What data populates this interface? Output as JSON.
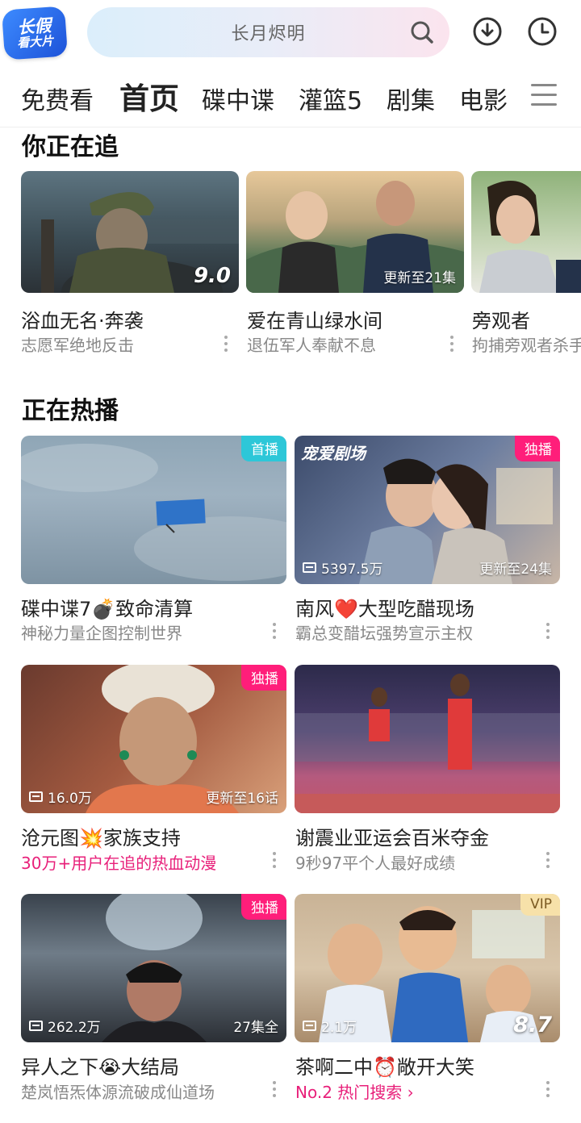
{
  "logo": {
    "line1": "长假",
    "line2": "看大片"
  },
  "search": {
    "placeholder": "长月烬明"
  },
  "icons": {
    "search": "search-icon",
    "download": "download-icon",
    "history": "history-icon",
    "menu": "menu-icon"
  },
  "tabs": [
    {
      "label": "免费看",
      "active": false
    },
    {
      "label": "首页",
      "active": true
    },
    {
      "label": "碟中谍",
      "active": false
    },
    {
      "label": "灌篮5",
      "active": false
    },
    {
      "label": "剧集",
      "active": false
    },
    {
      "label": "电影",
      "active": false
    }
  ],
  "following": {
    "title": "你正在追",
    "items": [
      {
        "title": "浴血无名·奔袭",
        "subtitle": "志愿军绝地反击",
        "overlay": "9.0"
      },
      {
        "title": "爱在青山绿水间",
        "subtitle": "退伍军人奉献不息",
        "overlay": "更新至21集"
      },
      {
        "title": "旁观者",
        "subtitle": "拘捕旁观者杀手",
        "overlay": ""
      }
    ]
  },
  "hot": {
    "title": "正在热播",
    "items": [
      {
        "title": "碟中谍7💣致命清算",
        "subtitle": "神秘力量企图控制世界",
        "badge": "首播",
        "views": "",
        "episodes": "",
        "score": ""
      },
      {
        "title": "南风❤️大型吃醋现场",
        "subtitle": "霸总变醋坛强势宣示主权",
        "badge": "独播",
        "views": "5397.5万",
        "episodes": "更新至24集",
        "score": "",
        "brand": "宠爱剧场"
      },
      {
        "title": "沧元图💥家族支持",
        "subtitle": "30万+用户在追的热血动漫",
        "badge": "独播",
        "views": "16.0万",
        "episodes": "更新至16话",
        "score": ""
      },
      {
        "title": "谢震业亚运会百米夺金",
        "subtitle": "9秒97平个人最好成绩",
        "badge": "",
        "views": "",
        "episodes": "",
        "score": ""
      },
      {
        "title": "异人之下😭大结局",
        "subtitle": "楚岚悟炁体源流破成仙道场",
        "badge": "独播",
        "views": "262.2万",
        "episodes": "27集全",
        "score": ""
      },
      {
        "title": "茶啊二中⏰敞开大笑",
        "subtitle": "No.2 热门搜索 ›",
        "badge": "VIP",
        "views": "2.1万",
        "episodes": "",
        "score": "8.7"
      }
    ]
  },
  "colors": {
    "accent_pink": "#ff1e7a",
    "badge_teal": "#2dc7d8",
    "vip_gold": "#f7e1a9"
  }
}
